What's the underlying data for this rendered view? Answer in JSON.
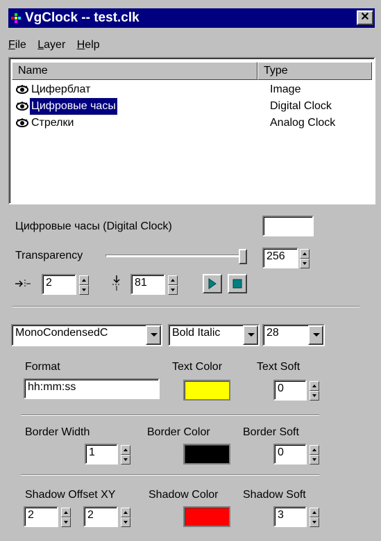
{
  "window": {
    "title": "VgClock -- test.clk",
    "close_label": "✕"
  },
  "menu": [
    {
      "label": "File",
      "hotkey": "F",
      "rest": "ile"
    },
    {
      "label": "Layer",
      "hotkey": "L",
      "rest": "ayer"
    },
    {
      "label": "Help",
      "hotkey": "H",
      "rest": "elp"
    }
  ],
  "layers": {
    "columns": {
      "name": "Name",
      "type": "Type"
    },
    "rows": [
      {
        "name": "Циферблат",
        "type": "Image",
        "selected": false,
        "icon": "eye-icon"
      },
      {
        "name": "Цифровые часы",
        "type": "Digital Clock",
        "selected": true,
        "icon": "eye-icon"
      },
      {
        "name": "Стрелки",
        "type": "Analog Clock",
        "selected": false,
        "icon": "eye-icon"
      }
    ]
  },
  "layer_props": {
    "layer_title": "Цифровые часы (Digital Clock)",
    "layer_name_value": "",
    "transparency_label": "Transparency",
    "transparency_value": "256",
    "transparency_level": 1.0,
    "offset_x_value": "2",
    "offset_y_value": "81",
    "play_icon": "play-icon",
    "stop_icon": "stop-icon"
  },
  "font": {
    "family": "MonoCondensedC",
    "style": "Bold Italic",
    "size": "28"
  },
  "text": {
    "format_label": "Format",
    "format_value": "hh:mm:ss",
    "color_label": "Text Color",
    "color_value": "#ffff00",
    "soft_label": "Text Soft",
    "soft_value": "0"
  },
  "border": {
    "width_label": "Border Width",
    "width_value": "1",
    "color_label": "Border Color",
    "color_value": "#000000",
    "soft_label": "Border Soft",
    "soft_value": "0"
  },
  "shadow": {
    "offset_label": "Shadow Offset XY",
    "offset_x_value": "2",
    "offset_y_value": "2",
    "color_label": "Shadow Color",
    "color_value": "#ff0000",
    "soft_label": "Shadow Soft",
    "soft_value": "3"
  }
}
